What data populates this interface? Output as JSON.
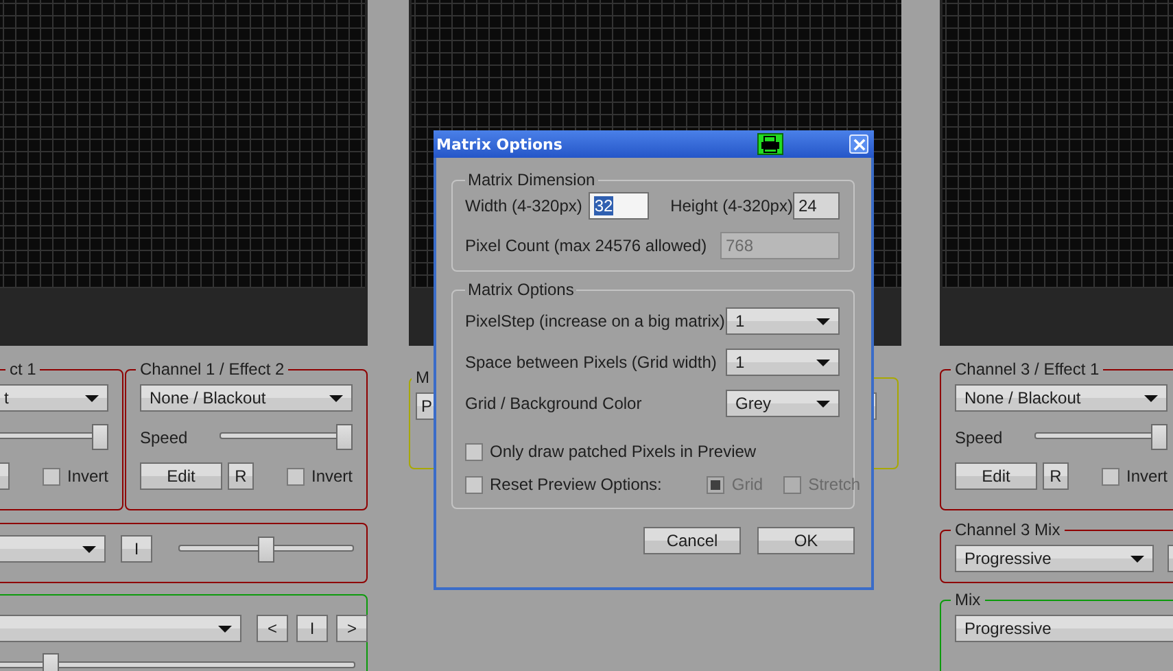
{
  "left_column": {
    "effect_1": {
      "legend": "ct 1",
      "effect": "t",
      "speed": {
        "level": 1
      },
      "invert": {
        "label": "Invert",
        "checked": false
      }
    },
    "effect_2": {
      "legend": "Channel 1 / Effect 2",
      "effect": "None / Blackout",
      "speed_label": "Speed",
      "speed": {
        "level": 1
      },
      "edit_button": "Edit",
      "reset_button": "R",
      "invert": {
        "label": "Invert",
        "checked": false
      }
    },
    "mix": {
      "button": "I",
      "fader": {
        "level": 0.5
      }
    },
    "master": {
      "buttons": [
        "<",
        "I",
        ">"
      ],
      "fader": {
        "level": 0.33
      }
    }
  },
  "middle_column": {
    "panel": {
      "legend": "M",
      "value": "P"
    }
  },
  "right_column": {
    "effect_1": {
      "legend": "Channel 3 / Effect 1",
      "effect": "None / Blackout",
      "speed_label": "Speed",
      "speed": {
        "level": 1
      },
      "edit_button": "Edit",
      "reset_button": "R",
      "invert": {
        "label": "Invert",
        "checked": false
      }
    },
    "mix": {
      "legend": "Channel 3 Mix",
      "value": "Progressive"
    },
    "master": {
      "legend": "Mix",
      "value": "Progressive"
    }
  },
  "dialog": {
    "title": "Matrix Options",
    "dimension": {
      "legend": "Matrix Dimension",
      "width_label": "Width (4-320px)",
      "width_value": "32",
      "height_label": "Height (4-320px)",
      "height_value": "24",
      "count_label": "Pixel Count (max 24576 allowed)",
      "count_value": "768"
    },
    "options": {
      "legend": "Matrix Options",
      "dropdowns": [
        {
          "label": "PixelStep (increase on a big matrix)",
          "value": "1"
        },
        {
          "label": "Space between Pixels (Grid width)",
          "value": "1"
        },
        {
          "label": "Grid / Background Color",
          "value": "Grey"
        }
      ],
      "only_patched": {
        "label": "Only draw patched Pixels in Preview",
        "checked": false,
        "disabled": false
      },
      "reset": {
        "label": "Reset Preview Options:",
        "checked": false,
        "disabled": false
      },
      "grid": {
        "label": "Grid",
        "checked": true,
        "disabled": true
      },
      "stretch": {
        "label": "Stretch",
        "checked": false,
        "disabled": true
      }
    },
    "buttons": [
      "Cancel",
      "OK"
    ]
  }
}
